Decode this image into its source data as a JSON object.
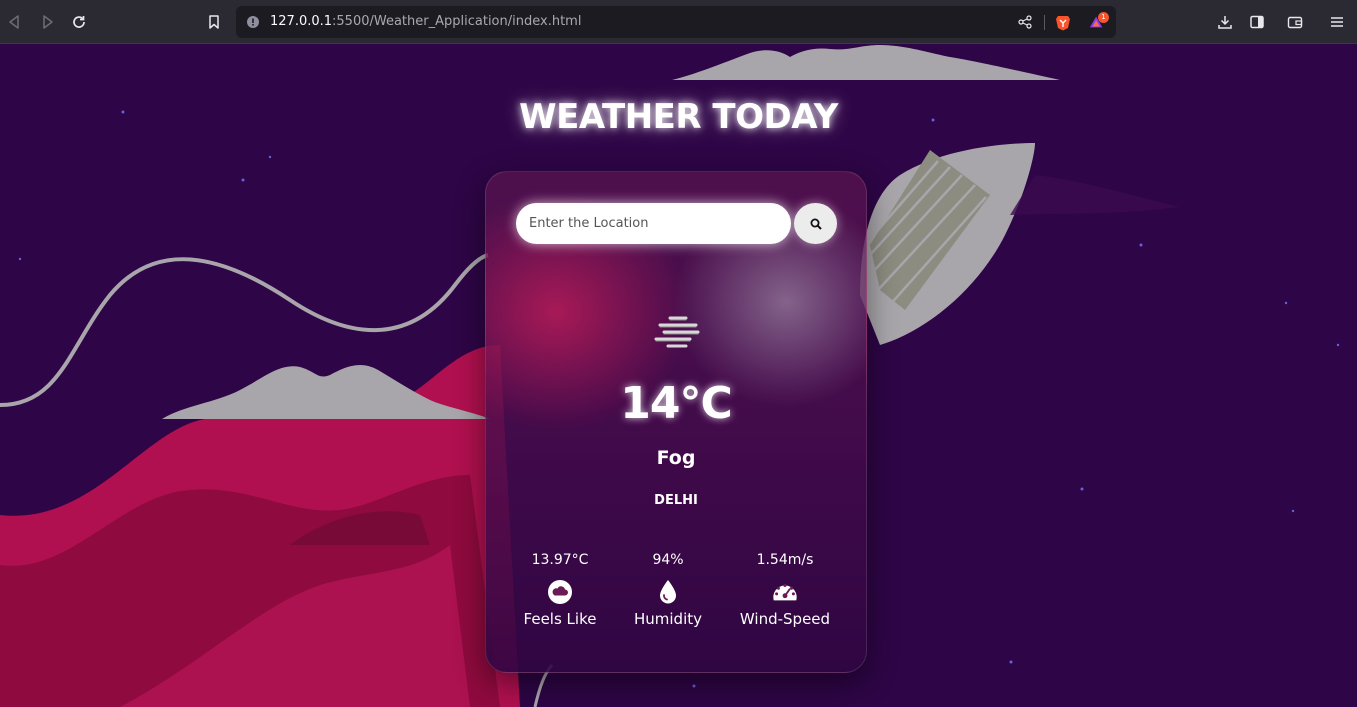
{
  "browser": {
    "url_host": "127.0.0.1",
    "url_rest": ":5500/Weather_Application/index.html",
    "notification_count": "1"
  },
  "page": {
    "title": "WEATHER TODAY"
  },
  "search": {
    "placeholder": "Enter the Location"
  },
  "weather": {
    "temperature": "14°C",
    "condition": "Fog",
    "city": "DELHI"
  },
  "stats": [
    {
      "value": "13.97°C",
      "label": "Feels Like",
      "icon": "cloud-icon"
    },
    {
      "value": "94%",
      "label": "Humidity",
      "icon": "droplet-icon"
    },
    {
      "value": "1.54m/s",
      "label": "Wind-Speed",
      "icon": "speedometer-icon"
    }
  ],
  "colors": {
    "background": "#2e0546",
    "accent_pink": "#b0104f",
    "cloud_gray": "#a9a6ab"
  }
}
